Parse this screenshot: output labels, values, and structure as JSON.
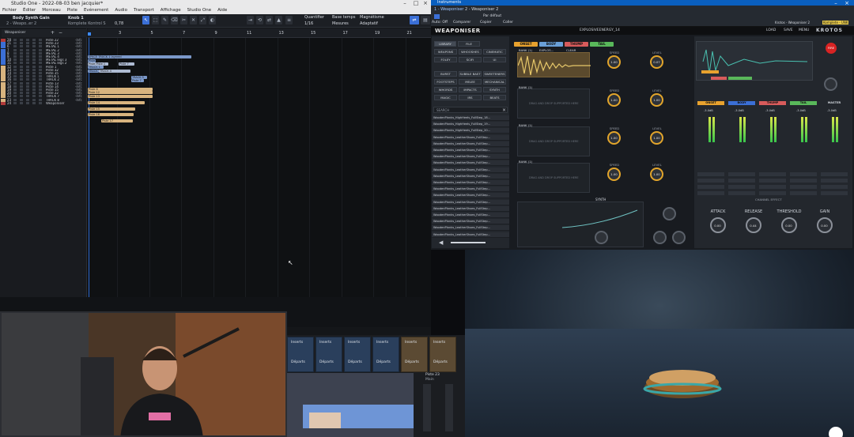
{
  "daw": {
    "title": "Studio One - 2022-08-03 ben jacquier*",
    "menu": [
      "Fichier",
      "Éditer",
      "Morceau",
      "Piste",
      "Evénement",
      "Audio",
      "Transport",
      "Affichage",
      "Studio One",
      "Aide"
    ],
    "instrument_name": "Body Synth Gain",
    "instrument_sub": "2 - Weapo..er 2",
    "knob_label": "Knob 1",
    "knob_sub": "Komplete Kontrol S",
    "knob_value": "0,78",
    "quantize_label": "Quantifier",
    "quantize_value": "1/16",
    "timebase_label": "Base temps",
    "timebase_value": "Mesures",
    "snap_label": "Magnétisme",
    "snap_value": "Adaptatif",
    "track_header": "Weaponiser",
    "ruler": [
      "3",
      "5",
      "7",
      "9",
      "11",
      "13",
      "15",
      "17",
      "19",
      "21"
    ],
    "tracks": [
      {
        "n": "28",
        "name": "Piste 22",
        "v": "-lnfc"
      },
      {
        "n": "21",
        "name": "Piste 23",
        "v": "-lnfc"
      },
      {
        "n": "6",
        "name": "METAL 1",
        "v": "-lnfc"
      },
      {
        "n": "7",
        "name": "METAL 2",
        "v": "-lnfc"
      },
      {
        "n": "8",
        "name": "METAL 3",
        "v": "-lnfc"
      },
      {
        "n": "9",
        "name": "METAL 4",
        "v": "-lnfc"
      },
      {
        "n": "10",
        "name": "METAL legs 3",
        "v": "-lnfc"
      },
      {
        "n": "11",
        "name": "METAL legs 2",
        "v": "-lnfc"
      },
      {
        "n": "12",
        "name": "Piste 1",
        "v": "-lnfc"
      },
      {
        "n": "13",
        "name": "Piste 32",
        "v": "-lnfc"
      },
      {
        "n": "14",
        "name": "Piste 35",
        "v": "-lnfc"
      },
      {
        "n": "15",
        "name": "TRACK 1",
        "v": "-lnfc"
      },
      {
        "n": "16",
        "name": "TRACK 2",
        "v": "-lnfc"
      },
      {
        "n": "17",
        "name": "Piste 13",
        "v": "-lnfc"
      },
      {
        "n": "18",
        "name": "Piste 14",
        "v": "-lnfc"
      },
      {
        "n": "19",
        "name": "Piste 15",
        "v": "-lnfc"
      },
      {
        "n": "20",
        "name": "Piste 22",
        "v": "-lnfc"
      },
      {
        "n": "22",
        "name": "TRACK 7",
        "v": "-lnfc"
      },
      {
        "n": "23",
        "name": "TRACK 8",
        "v": "-lnfc"
      },
      {
        "n": "24",
        "name": "Weaponiser",
        "v": ""
      }
    ],
    "clips": [
      {
        "label": "SPACE TRUCK 1 layered"
      },
      {
        "label": "Piste"
      },
      {
        "label": "Piste Piste 1"
      },
      {
        "label": "Piste 7"
      },
      {
        "label": "TRACK 1"
      },
      {
        "label": "TRACK 3 TRACK 2"
      },
      {
        "label": "TRACK 4"
      },
      {
        "label": "TRACK 5"
      },
      {
        "label": "Piste 7"
      },
      {
        "label": "Piste 8"
      },
      {
        "label": "Piste 12"
      },
      {
        "label": "Piste 13"
      },
      {
        "label": "Piste 14"
      },
      {
        "label": "Piste 15"
      },
      {
        "label": "Piste 16"
      },
      {
        "label": "Piste 17"
      }
    ]
  },
  "instrument_window": {
    "title": "Instruments",
    "track_select": "1 - Weaponiser",
    "preset_select": "2 - Weaponiser 2",
    "default_label": "Par défaut",
    "auto_label": "Auto: Off",
    "compare_label": "Comparer",
    "copy_label": "Copier",
    "paste_label": "Coller",
    "host_label": "Krotos - Weaponiser 2",
    "host_mode": "Komplete - UNK"
  },
  "weaponiser": {
    "brand": "WEAPONISER",
    "preset": "EXPLOSIVEENERGY_14",
    "load": "LOAD",
    "save": "SAVE",
    "menu": "MENU",
    "maker": "KROTOS",
    "tabs": [
      {
        "label": "ONSET",
        "color": "#e8a22e"
      },
      {
        "label": "BODY",
        "color": "#6aa0d8"
      },
      {
        "label": "THUMP",
        "color": "#d85b5b"
      },
      {
        "label": "TAIL",
        "color": "#59b85a"
      }
    ],
    "library_buttons": [
      "LIBRARY",
      "FILE"
    ],
    "category_buttons": [
      "WEAPONS",
      "WHOOSHES",
      "CINEMATIC",
      "FOLEY",
      "SCIFI",
      "UI",
      "BURST",
      "SUBBLE BAST",
      "SWEETENERS",
      "FOOTSTEPS",
      "MELEE",
      "MECHANICAL",
      "WHORDS",
      "IMPACTS",
      "SYNTH",
      "MAGIC",
      "IRS",
      "BEATS"
    ],
    "search_label": "SEARCH",
    "file_list": [
      "WoodenPlanks_HighHeels_FullStep_18...",
      "WoodenPlanks_HighHeels_FullStep_19...",
      "WoodenPlanks_HighHeels_FullStep_20...",
      "WoodenPlanks_LeatherShoes_FullStep...",
      "WoodenPlanks_LeatherShoes_FullStep...",
      "WoodenPlanks_LeatherShoes_FullStep...",
      "WoodenPlanks_LeatherShoes_FullStep...",
      "WoodenPlanks_LeatherShoes_FullStep...",
      "WoodenPlanks_LeatherShoes_FullStep...",
      "WoodenPlanks_LeatherShoes_FullStep...",
      "WoodenPlanks_LeatherShoes_FullStep...",
      "WoodenPlanks_LeatherShoes_FullStep...",
      "WoodenPlanks_LeatherShoes_FullStep...",
      "WoodenPlanks_LeatherShoes_FullStep...",
      "WoodenPlanks_LeatherShoes_FullStep...",
      "WoodenPlanks_LeatherShoes_FullStep...",
      "WoodenPlanks_LeatherShoes_FullStep...",
      "WoodenPlanks_LeatherShoes_FullStep...",
      "WoodenPlanks_LeatherShoes_FullStep..."
    ],
    "bank_label": "BANK (1)",
    "bank_sample": "EXPLOS...",
    "clear_label": "CLEAR",
    "slot_drop": "DRAG AND DROP SUPPORTED HERE",
    "speed_label": "SPEED",
    "level_label": "LEVEL",
    "knob_one": "1.00",
    "knob_level": "0.07",
    "synth_label": "SYNTH",
    "big_knobs": [
      "ATTACK",
      "RELEASE",
      "THRESHOLD",
      "GAIN"
    ],
    "big_knob_values": [
      "0.00",
      "0.44",
      "0.00",
      "0.00"
    ],
    "mixer_headers": [
      "ONSET",
      "BODY",
      "THUMP",
      "TAIL",
      "MASTER"
    ],
    "mixer_values": [
      "-3.0dB",
      "-3.0dB",
      "-3.0dB",
      "-3.0dB",
      "-3.0dB"
    ],
    "channel_fx": "CHANNEL EFFECT",
    "fire_label": "FIRE"
  },
  "mixer": {
    "inserts_label": "Inserts",
    "departs_label": "Départs",
    "strip_label": "Piste 23",
    "strip_sub": "Main",
    "red_tab": "M"
  }
}
